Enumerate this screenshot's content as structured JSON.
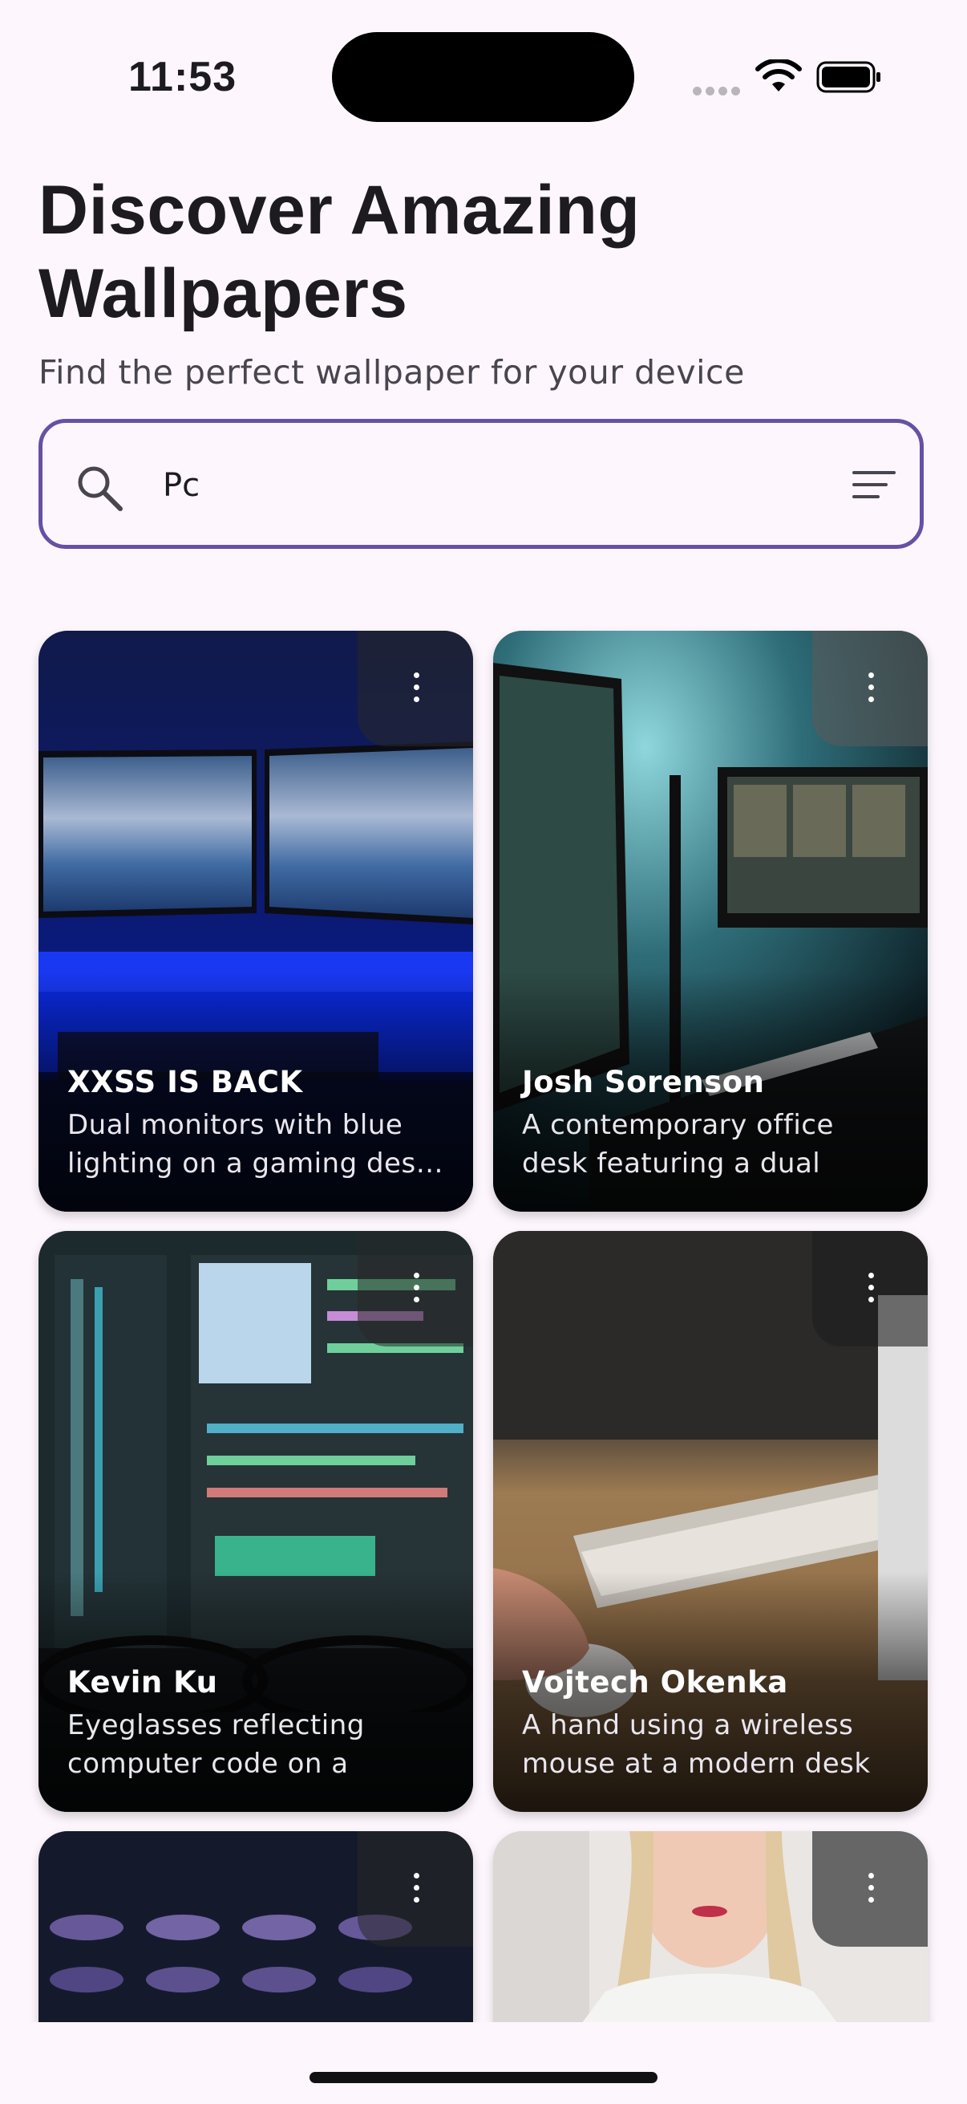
{
  "status_bar": {
    "time": "11:53"
  },
  "header": {
    "title": "Discover Amazing Wallpapers",
    "subtitle": "Find the perfect wallpaper for your device"
  },
  "search": {
    "value": "Pc",
    "icon": "search-icon",
    "filter_icon": "filter-icon",
    "accent": "#6750a4"
  },
  "wallpapers": [
    {
      "author": "XXSS IS BACK",
      "description": "Dual monitors with blue lighting on a gaming des…"
    },
    {
      "author": "Josh Sorenson",
      "description": "A contemporary office desk featuring a dual mo…"
    },
    {
      "author": "Kevin Ku",
      "description": "Eyeglasses reflecting computer code on a moni…"
    },
    {
      "author": "Vojtech Okenka",
      "description": "A hand using a wireless mouse at a modern desk …"
    },
    {
      "author": "",
      "description": ""
    },
    {
      "author": "",
      "description": ""
    }
  ]
}
